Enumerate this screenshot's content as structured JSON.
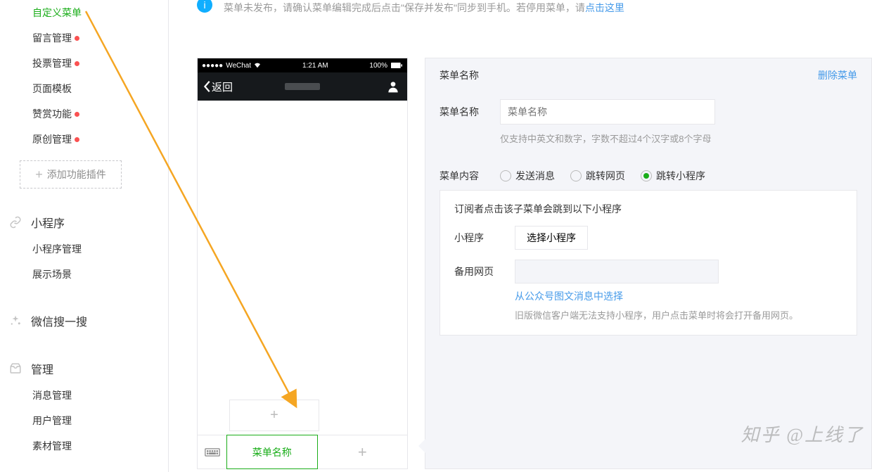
{
  "sidebar": {
    "items": [
      {
        "label": "自定义菜单",
        "active": true,
        "dot": false
      },
      {
        "label": "留言管理",
        "active": false,
        "dot": true
      },
      {
        "label": "投票管理",
        "active": false,
        "dot": true
      },
      {
        "label": "页面模板",
        "active": false,
        "dot": false
      },
      {
        "label": "赞赏功能",
        "active": false,
        "dot": true
      },
      {
        "label": "原创管理",
        "active": false,
        "dot": true
      }
    ],
    "add_plugin": "添加功能插件",
    "groups": [
      {
        "title": "小程序",
        "icon": "link",
        "subs": [
          "小程序管理",
          "展示场景"
        ]
      },
      {
        "title": "微信搜一搜",
        "icon": "sparkle",
        "subs": []
      },
      {
        "title": "管理",
        "icon": "inbox",
        "subs": [
          "消息管理",
          "用户管理",
          "素材管理"
        ]
      }
    ]
  },
  "notice": {
    "text_before": "菜单未发布，请确认菜单编辑完成后点击\"保存并发布\"同步到手机。若停用菜单，请",
    "link": "点击这里"
  },
  "phone": {
    "carrier": "WeChat",
    "time": "1:21 AM",
    "battery": "100%",
    "back": "返回",
    "menu_active": "菜单名称"
  },
  "panel": {
    "title": "菜单名称",
    "delete": "删除菜单",
    "name_label": "菜单名称",
    "name_placeholder": "菜单名称",
    "name_hint": "仅支持中英文和数字，字数不超过4个汉字或8个字母",
    "content_label": "菜单内容",
    "radios": [
      "发送消息",
      "跳转网页",
      "跳转小程序"
    ],
    "sub": {
      "desc": "订阅者点击该子菜单会跳到以下小程序",
      "miniapp_label": "小程序",
      "miniapp_btn": "选择小程序",
      "fallback_label": "备用网页",
      "fallback_link": "从公众号图文消息中选择",
      "fallback_hint": "旧版微信客户端无法支持小程序，用户点击菜单时将会打开备用网页。"
    }
  },
  "watermark": "知乎 @上线了"
}
